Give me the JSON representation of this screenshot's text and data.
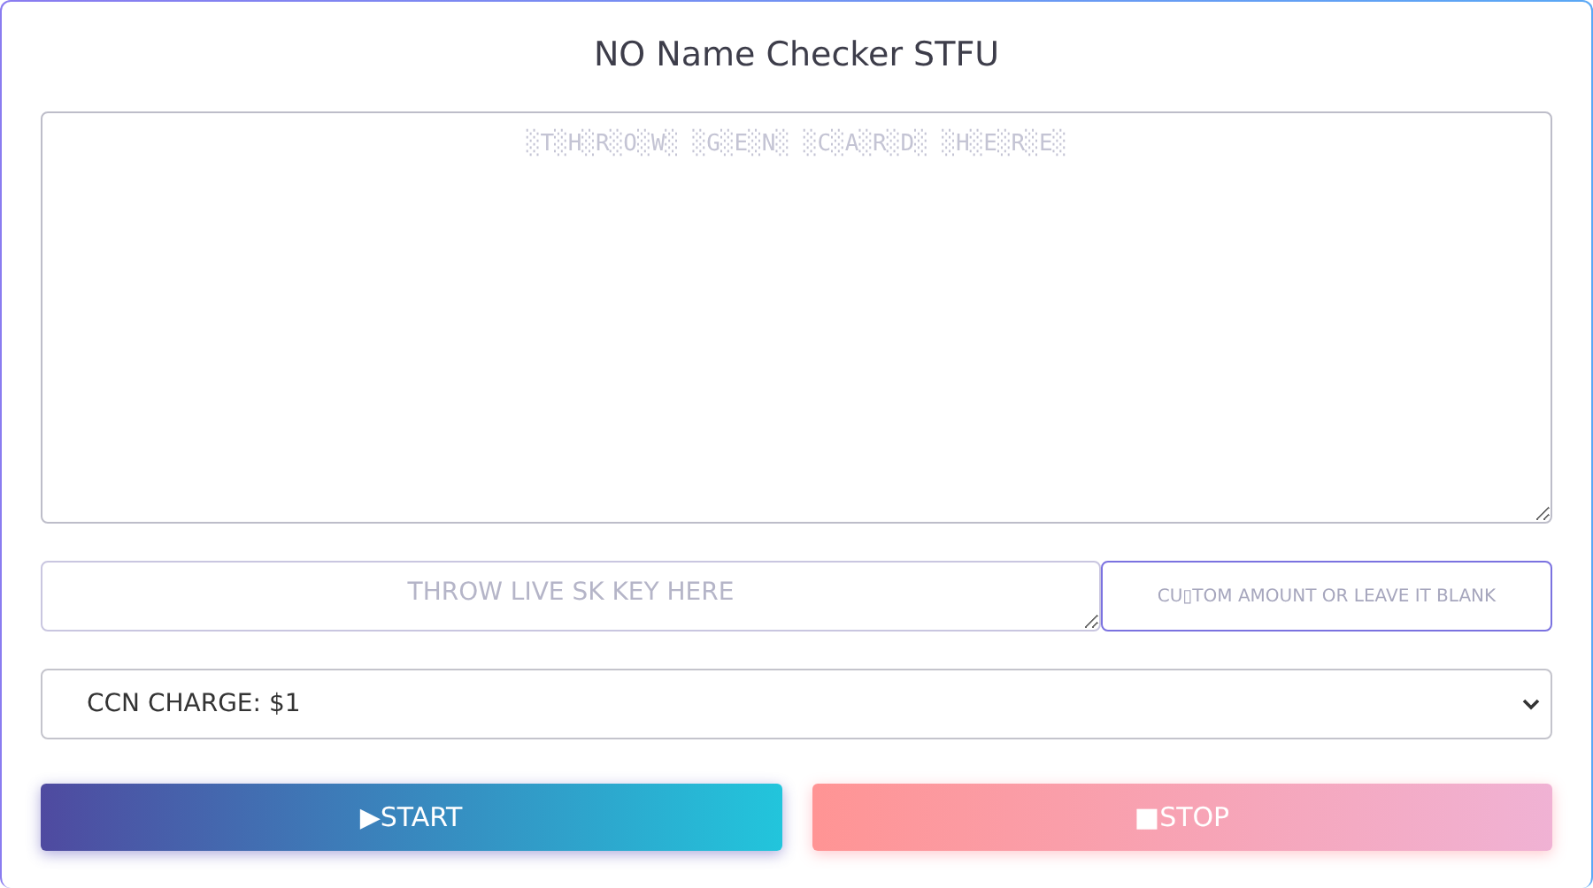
{
  "title": "NO Name Checker STFU",
  "cards_field": {
    "placeholder": "░T░H░R░O░W░ ░G░E░N░ ░C░A░R░D░ ░H░E░R░E░"
  },
  "sk_key_field": {
    "placeholder": "THROW LIVE SK KEY HERE",
    "focused": false
  },
  "amount_field": {
    "placeholder": "CU▯TOM AMOUNT OR LEAVE IT BLANK",
    "focused": true
  },
  "charge_select": {
    "value": "CCN CHARGE: $1"
  },
  "buttons": [
    {
      "kind": "start",
      "icon": "▶",
      "label": "START"
    },
    {
      "kind": "stop",
      "icon": "■",
      "label": "STOP"
    }
  ]
}
